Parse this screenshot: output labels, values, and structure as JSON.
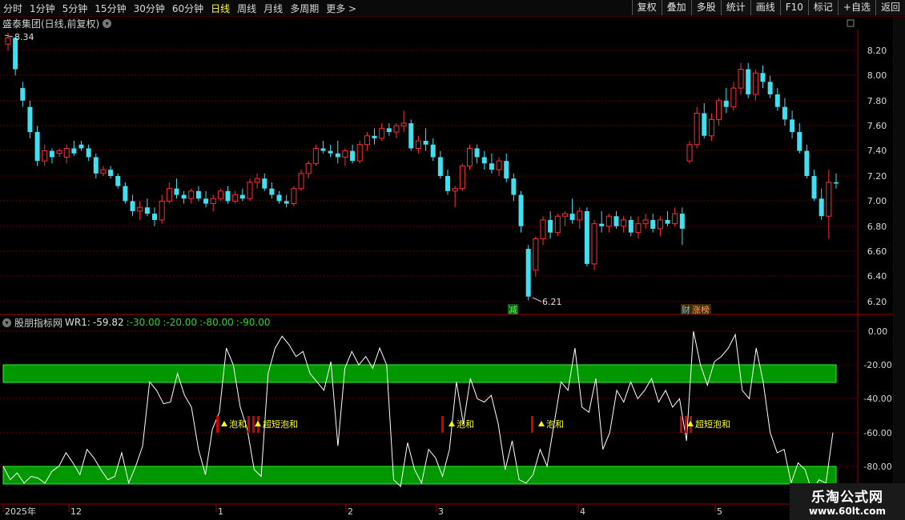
{
  "toolbar": {
    "periods": [
      "分时",
      "1分钟",
      "5分钟",
      "15分钟",
      "30分钟",
      "60分钟",
      "日线",
      "周线",
      "月线",
      "多周期",
      "更多 >"
    ],
    "active_index": 6,
    "buttons": [
      "复权",
      "叠加",
      "多股",
      "统计",
      "画线",
      "F10",
      "标记",
      "+自选",
      "返回"
    ]
  },
  "chart_title": "盛泰集团(日线,前复权)",
  "price_axis": [
    "8.20",
    "8.00",
    "7.80",
    "7.60",
    "7.40",
    "7.20",
    "7.00",
    "6.80",
    "6.60",
    "6.40",
    "6.20"
  ],
  "annotations": {
    "high_label": "8.34",
    "low_label": "6.21",
    "badge_left": "减",
    "badge_right_1": "财",
    "badge_right_2": "涨榜"
  },
  "indicator": {
    "name": "股朋指标网",
    "wr_label": "WR1:",
    "wr_value": "-59.82",
    "levels": [
      ":-30.00",
      ":-20.00",
      ":-80.00",
      ":-90.00"
    ],
    "axis": [
      "0.00",
      "-20.00",
      "-40.00",
      "-60.00",
      "-80.00"
    ],
    "signal_text": "泡和",
    "signal_multi": "超短泡和"
  },
  "date_axis": [
    "2025年",
    "12",
    "1",
    "2",
    "3",
    "4",
    "5"
  ],
  "watermark": {
    "line1": "乐淘公式网",
    "line2": "www.60lt.com"
  },
  "colors": {
    "up": "#ff3030",
    "down": "#40e0f0",
    "band": "#00a000",
    "signal": "#ffff00",
    "grid": "#7a0000"
  }
}
